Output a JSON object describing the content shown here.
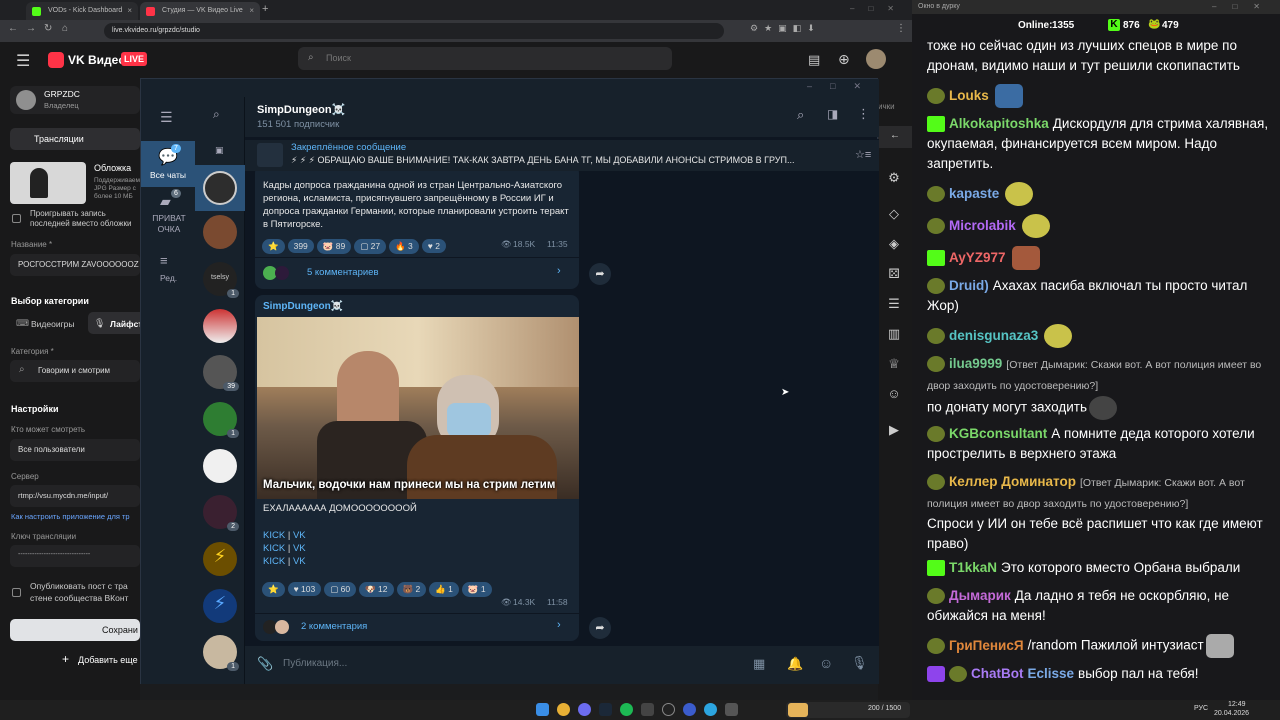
{
  "browser": {
    "tabs": [
      {
        "label": "VODs - Kick Dashboard"
      },
      {
        "label": "Студия — VK Видео Live"
      }
    ],
    "url": "live.vkvideo.ru/grpzdc/studio"
  },
  "vk": {
    "logo": "VK Видео",
    "live": "LIVE",
    "search_placeholder": "Поиск",
    "channel_name": "GRPZDC",
    "channel_role": "Владелец",
    "broadcasts_tab": "Трансляции",
    "cover_label": "Обложка",
    "cover_hint": "Поддерживаемые JPG Размер с более 10 МБ",
    "replay_checkbox": "Проигрывать запись последней вместо обложки",
    "name_label": "Название *",
    "name_value": "РОСГОССТРИМ ZAVOOOOOOZ",
    "category_title": "Выбор категории",
    "cat_games": "Видеоигры",
    "cat_life": "Лайфст",
    "category_label": "Категория *",
    "category_value": "Говорим и смотрим",
    "settings_title": "Настройки",
    "who_label": "Кто может смотреть",
    "who_value": "Все пользователи",
    "server_label": "Сервер",
    "server_value": "rtmp://vsu.mycdn.me/input/",
    "setup_link": "Как настроить приложение для тр",
    "key_label": "Ключ трансляции",
    "key_value": "-------------------------------",
    "publish_checkbox": "Опубликовать пост с тра стене сообщества ВКонт",
    "save_button": "Сохрани",
    "add_button": "Добавить еще",
    "right_edge_text": "ички"
  },
  "telegram": {
    "rail": {
      "all_chats": "Все чаты",
      "all_badge": "7",
      "private": "ПРИВАТ ОЧКА",
      "private_badge": "6",
      "edit": "Ред."
    },
    "chat_list_badges": [
      "",
      "",
      "",
      "1",
      "",
      "39",
      "1",
      "",
      "2",
      "",
      "",
      "1"
    ],
    "chat_list_text": "tselsy",
    "channel_title": "SimpDungeon☠️",
    "subscribers": "151 501 подписчик",
    "pinned_title": "Закреплённое сообщение",
    "pinned_text": "⚡ ⚡ ⚡ ОБРАЩАЮ ВАШЕ ВНИМАНИЕ! ТАК-КАК ЗАВТРА ДЕНЬ БАНА ТГ, МЫ ДОБАВИЛИ АНОНСЫ СТРИМОВ В ГРУП...",
    "msg1": {
      "text": "Кадры допроса гражданина одной из стран Центрально-Азиатского региона, исламиста, присягнувшего запрещённому в России ИГ и допроса гражданки Германии, которые планировали устроить теракт в Пятигорске.",
      "reactions": [
        "⭐",
        "399",
        "89",
        "27",
        "3",
        "2"
      ],
      "views": "18.5K",
      "time": "11:35",
      "comments": "5 комментариев"
    },
    "msg2": {
      "author": "SimpDungeon☠️",
      "caption": "Мальчик, водочки нам принеси  мы на стрим летим",
      "text": "ЕХАЛАААААА ДОМООООООООЙ",
      "links": [
        {
          "a": "KICK",
          "sep": "|",
          "b": "VK"
        },
        {
          "a": "KICK",
          "sep": "|",
          "b": "VK"
        },
        {
          "a": "KICK",
          "sep": "|",
          "b": "VK"
        }
      ],
      "reactions": [
        "⭐",
        "103",
        "60",
        "12",
        "2",
        "1",
        "1"
      ],
      "views": "14.3K",
      "time": "11:58",
      "comments": "2 комментария"
    },
    "input_placeholder": "Публикация..."
  },
  "chatwin": {
    "title": "Окно в дурку",
    "online_label": "Online:",
    "online_value": "1355",
    "kick_count": "876",
    "other_count": "479",
    "messages": [
      {
        "user": "",
        "color": "#ffffff",
        "text": "тоже но сейчас один из лучших спецов в мире по дронам, видимо наши и тут решили скопипастить"
      },
      {
        "user": "Louks",
        "color": "#e8b84a",
        "text": ""
      },
      {
        "user": "Alkokapitoshka",
        "color": "#7bd86a",
        "text": "Дискордуля для стрима халявная, окупаемая, финансируется всем миром. Надо запретить."
      },
      {
        "user": "kapaste",
        "color": "#7aa9e6",
        "text": ""
      },
      {
        "user": "Microlabik",
        "color": "#b36af5",
        "text": ""
      },
      {
        "user": "AyYZ977",
        "color": "#ef6767",
        "text": ""
      },
      {
        "user": "Druid)",
        "color": "#7aa9e6",
        "text": "Ахахах пасиба включал ты просто читал Жор)"
      },
      {
        "user": "denisgunaza3",
        "color": "#56c4c4",
        "text": ""
      },
      {
        "user": "ilua9999",
        "color": "#74c98e",
        "text": "по донату могут заходить",
        "reply": "[Ответ Дымарик: Скажи вот. А вот полиция имеет во двор заходить по удостоверению?]"
      },
      {
        "user": "KGBconsultant",
        "color": "#7bd86a",
        "text": "А помните деда которого хотели прострелить в верхнего этажа"
      },
      {
        "user": "Келлер Доминатор",
        "color": "#e8b84a",
        "text": "Спроси у ИИ он тебе всё распишет что как где имеют право)",
        "reply": "[Ответ Дымарик: Скажи вот. А вот полиция имеет во двор заходить по удостоверению?]"
      },
      {
        "user": "T1kkaN",
        "color": "#7bd86a",
        "text": "Это которого вместо Орбана выбрали"
      },
      {
        "user": "Дымарик",
        "color": "#c46ad8",
        "text": "Да ладно я тебя не оскорбляю, не обижайся на меня!"
      },
      {
        "user": "ГриПенисЯ",
        "color": "#e0873b",
        "text": "/random Пажилой интузиаст"
      },
      {
        "user": "ChatBot",
        "color": "#a97bf5",
        "text": "выбор пал на тебя!",
        "mention": "Eclisse"
      }
    ]
  },
  "taskbar": {
    "lang": "РУС",
    "time": "12:49",
    "date": "20.04.2026",
    "widget": "200 / 1500"
  },
  "colors": {
    "tg_accent": "#5eb5f7",
    "vk_red": "#ff3347",
    "kick_green": "#53fc18"
  }
}
